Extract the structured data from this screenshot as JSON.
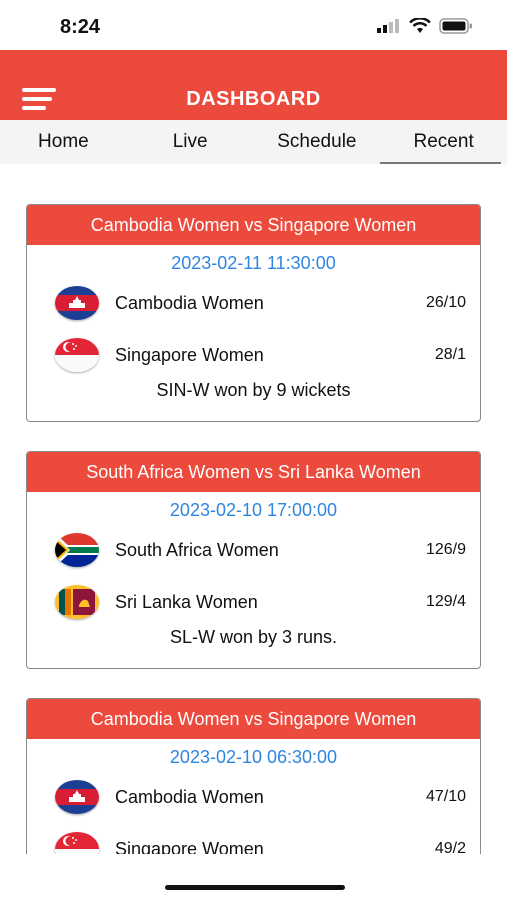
{
  "status": {
    "time": "8:24"
  },
  "header": {
    "title": "DASHBOARD"
  },
  "tabs": [
    {
      "label": "Home"
    },
    {
      "label": "Live"
    },
    {
      "label": "Schedule"
    },
    {
      "label": "Recent"
    }
  ],
  "colors": {
    "accent": "#ec4a3d",
    "date": "#2f86e0"
  },
  "matches": [
    {
      "title": "Cambodia Women vs Singapore Women",
      "datetime": "2023-02-11 11:30:00",
      "teams": [
        {
          "name": "Cambodia Women",
          "score": "26/10",
          "flag": "cambodia-flag-icon"
        },
        {
          "name": "Singapore Women",
          "score": "28/1",
          "flag": "singapore-flag-icon"
        }
      ],
      "result": "SIN-W won by 9 wickets"
    },
    {
      "title": "South Africa Women vs Sri Lanka Women",
      "datetime": "2023-02-10 17:00:00",
      "teams": [
        {
          "name": "South Africa Women",
          "score": "126/9",
          "flag": "south-africa-flag-icon"
        },
        {
          "name": "Sri Lanka Women",
          "score": "129/4",
          "flag": "sri-lanka-flag-icon"
        }
      ],
      "result": "SL-W won by 3 runs."
    },
    {
      "title": "Cambodia Women vs Singapore Women",
      "datetime": "2023-02-10 06:30:00",
      "teams": [
        {
          "name": "Cambodia Women",
          "score": "47/10",
          "flag": "cambodia-flag-icon"
        },
        {
          "name": "Singapore Women",
          "score": "49/2",
          "flag": "singapore-flag-icon"
        }
      ],
      "result": ""
    }
  ]
}
